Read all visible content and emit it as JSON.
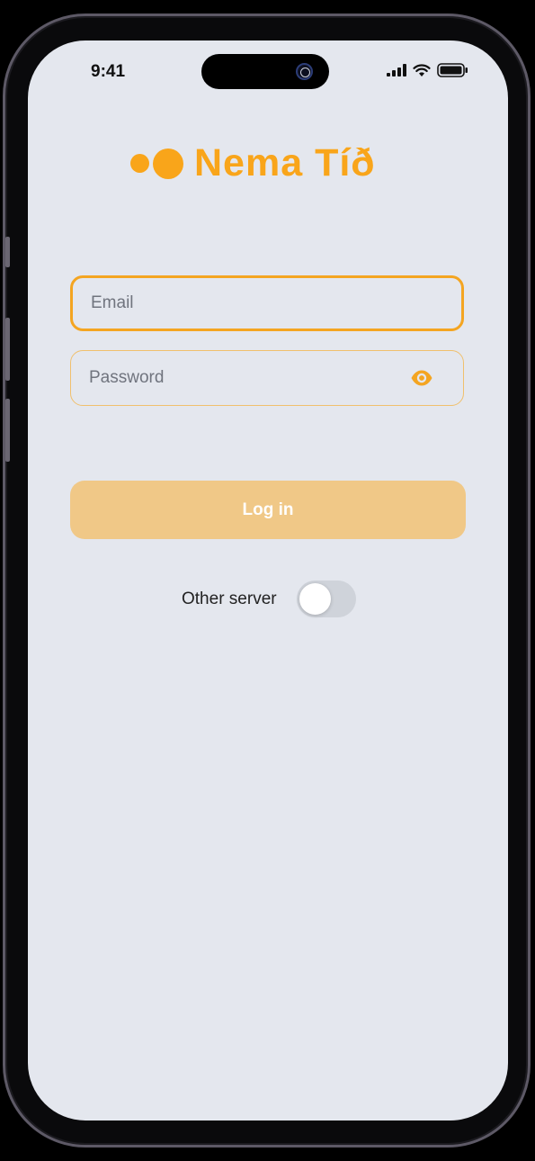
{
  "status_bar": {
    "time": "9:41"
  },
  "brand": {
    "name": "Nema Tíð",
    "color": "#f9a51a"
  },
  "form": {
    "email_placeholder": "Email",
    "email_value": "",
    "password_placeholder": "Password",
    "password_value": "",
    "login_label": "Log in"
  },
  "server": {
    "label": "Other server",
    "enabled": false
  },
  "icons": {
    "signal": "cellular-signal-icon",
    "wifi": "wifi-icon",
    "battery": "battery-icon",
    "eye": "eye-icon",
    "logo": "logo-dots-icon"
  }
}
